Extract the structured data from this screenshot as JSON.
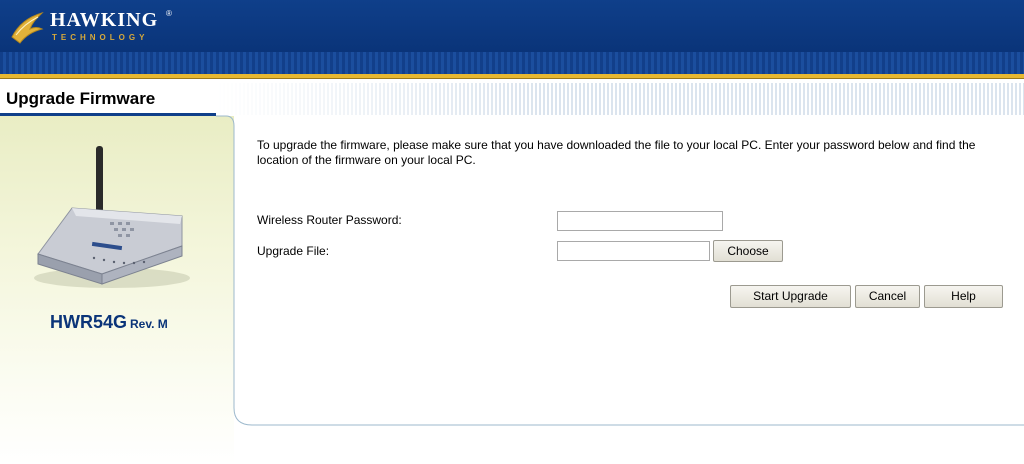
{
  "brand": {
    "name": "HAWKING",
    "tagline": "TECHNOLOGY",
    "registered": "®",
    "logo_icon": "hawk-icon",
    "colors": {
      "navy": "#0a3479",
      "gold": "#e8b830"
    }
  },
  "page": {
    "title": "Upgrade Firmware"
  },
  "product": {
    "model": "HWR54G",
    "revision": "Rev. M",
    "image_icon": "router-icon"
  },
  "content": {
    "intro": "To upgrade the firmware, please make sure that you have downloaded the file to your local PC.  Enter your password below and find the location of the firmware on your local PC."
  },
  "form": {
    "password_label": "Wireless Router Password:",
    "password_value": "",
    "file_label": "Upgrade File:",
    "file_value": "",
    "choose_label": "Choose"
  },
  "actions": {
    "start_label": "Start Upgrade",
    "cancel_label": "Cancel",
    "help_label": "Help"
  }
}
